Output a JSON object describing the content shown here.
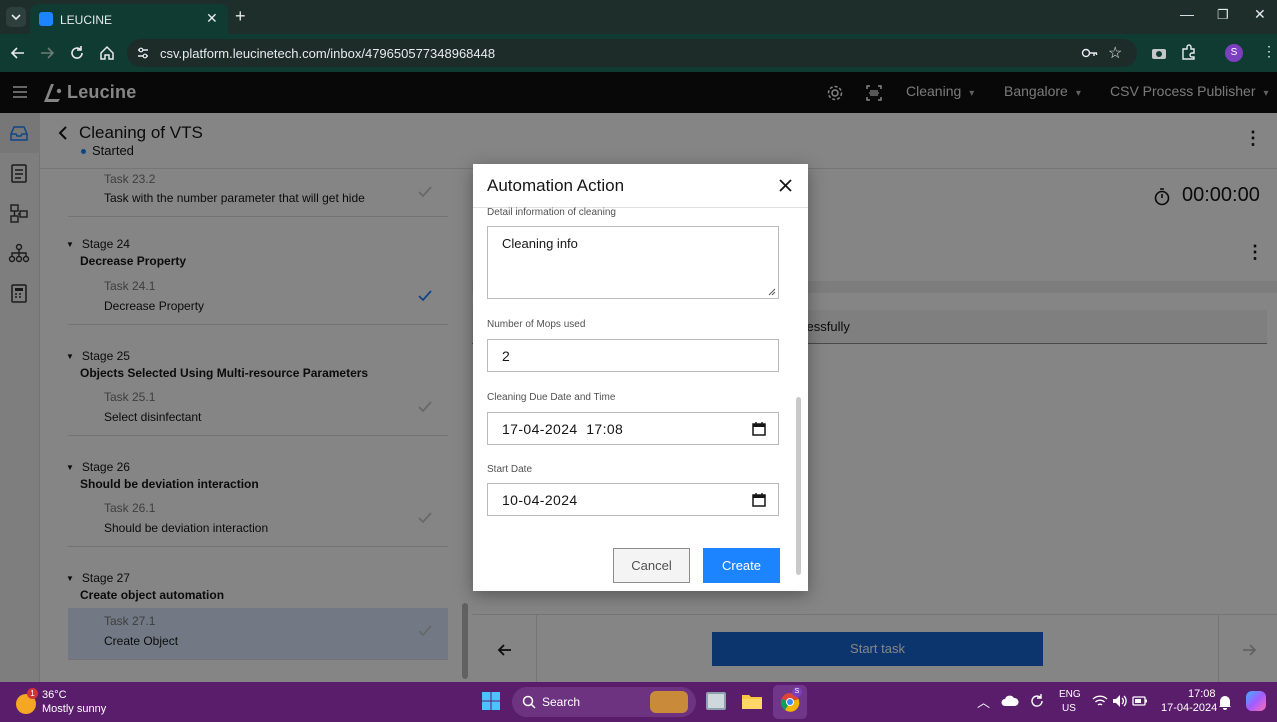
{
  "browser": {
    "tab_title": "LEUCINE",
    "url": "csv.platform.leucinetech.com/inbox/479650577348968448",
    "profile_initial": "S"
  },
  "app": {
    "brand": "Leucine",
    "nav": {
      "use_case": "Cleaning",
      "facility": "Bangalore",
      "role": "CSV Process Publisher"
    }
  },
  "job": {
    "title": "Cleaning of VTS",
    "status": "Started",
    "timer": "00:00:00",
    "partial_message": "cessfully"
  },
  "tasks": [
    {
      "type": "task",
      "number": "Task 23.2",
      "name": "Task with the number parameter that will get hide",
      "completed": false
    },
    {
      "type": "stage",
      "stage": "Stage 24",
      "name": "Decrease Property"
    },
    {
      "type": "task",
      "number": "Task 24.1",
      "name": "Decrease Property",
      "completed": true
    },
    {
      "type": "stage",
      "stage": "Stage 25",
      "name": "Objects Selected Using Multi-resource Parameters"
    },
    {
      "type": "task",
      "number": "Task 25.1",
      "name": "Select disinfectant",
      "completed": false
    },
    {
      "type": "stage",
      "stage": "Stage 26",
      "name": "Should be deviation interaction"
    },
    {
      "type": "task",
      "number": "Task 26.1",
      "name": "Should be deviation interaction",
      "completed": false
    },
    {
      "type": "stage",
      "stage": "Stage 27",
      "name": "Create object automation"
    },
    {
      "type": "task",
      "number": "Task 27.1",
      "name": "Create Object",
      "completed": false,
      "selected": true
    }
  ],
  "footer": {
    "start_task_label": "Start task"
  },
  "modal": {
    "title": "Automation Action",
    "fields": {
      "detail_label": "Detail information of cleaning",
      "detail_value": "Cleaning info",
      "mops_label": "Number of Mops used",
      "mops_value": "2",
      "due_label": "Cleaning Due Date and Time",
      "due_value": "17-04-2024  17:08",
      "start_label": "Start Date",
      "start_value": "10-04-2024"
    },
    "cancel_label": "Cancel",
    "create_label": "Create"
  },
  "taskbar": {
    "weather_temp": "36°C",
    "weather_desc": "Mostly sunny",
    "weather_badge": "1",
    "search_label": "Search",
    "lang_top": "ENG",
    "lang_bottom": "US",
    "time": "17:08",
    "date": "17-04-2024"
  },
  "colors": {
    "primary": "#1d84ff",
    "start_task_bg": "#1967d2",
    "taskbar": "#5a1d6c",
    "browser_toolbar": "#0f3b33"
  }
}
